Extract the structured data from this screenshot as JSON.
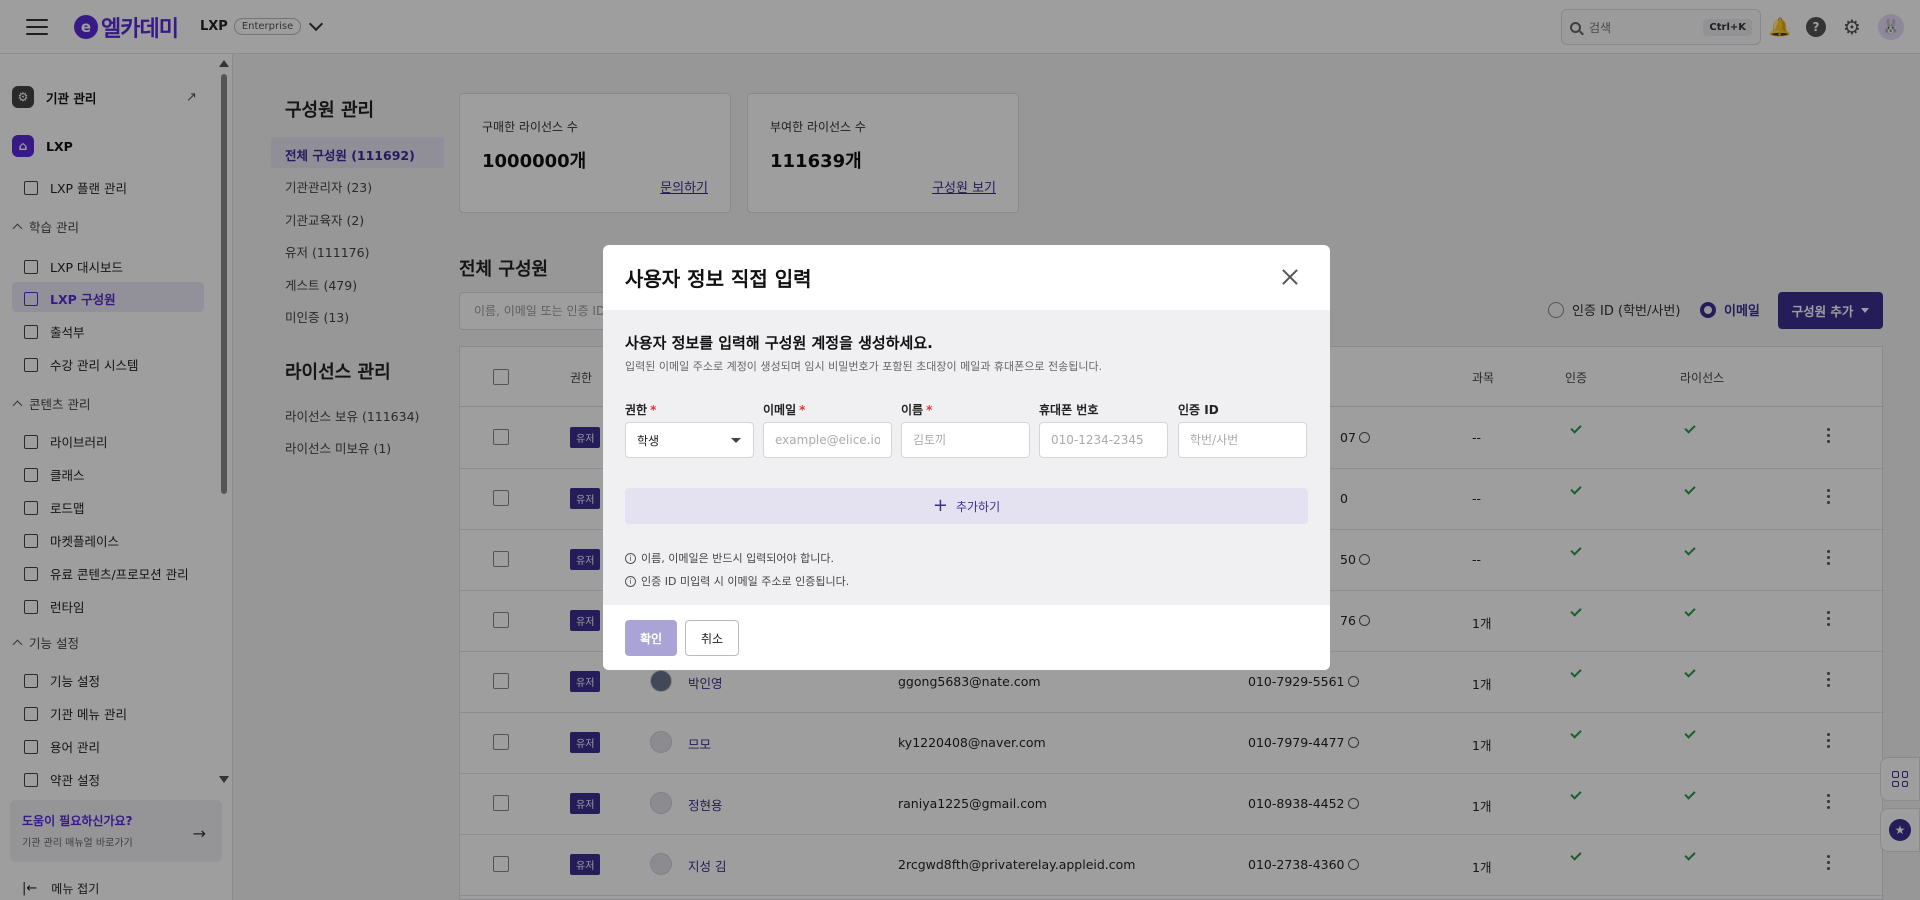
{
  "topbar": {
    "logo_mark": "e",
    "logo_text": "엘카데미",
    "product": "LXP",
    "edition": "Enterprise",
    "search_placeholder": "검색",
    "search_shortcut": "Ctrl+K"
  },
  "sidebar": {
    "org_manage": "기관 관리",
    "lxp": "LXP",
    "lxp_plan": "LXP 플랜 관리",
    "group_learning": "학습 관리",
    "lxp_dashboard": "LXP 대시보드",
    "lxp_members": "LXP 구성원",
    "attendance": "출석부",
    "enrollment": "수강 관리 시스템",
    "group_content": "콘텐츠 관리",
    "library": "라이브러리",
    "class": "클래스",
    "roadmap": "로드맵",
    "marketplace": "마켓플레이스",
    "paid_content": "유료 콘텐츠/프로모션 관리",
    "runtime": "런타임",
    "group_features": "기능 설정",
    "feature_settings": "기능 설정",
    "org_menu": "기관 메뉴 관리",
    "terms": "용어 관리",
    "policy": "약관 설정",
    "help_title": "도움이 필요하신가요?",
    "help_sub": "기관 관리 매뉴얼 바로가기",
    "collapse": "메뉴 접기"
  },
  "member_nav": {
    "title": "구성원 관리",
    "items": [
      "전체 구성원 (111692)",
      "기관관리자 (23)",
      "기관교육자 (2)",
      "유저 (111176)",
      "게스트 (479)",
      "미인증 (13)"
    ],
    "license_title": "라이선스 관리",
    "license_items": [
      "라이선스 보유 (111634)",
      "라이선스 미보유 (1)"
    ]
  },
  "cards": [
    {
      "label": "구매한 라이선스 수",
      "value": "1000000개",
      "link": "문의하기"
    },
    {
      "label": "부여한 라이선스 수",
      "value": "111639개",
      "link": "구성원 보기"
    }
  ],
  "list": {
    "title": "전체 구성원",
    "filter_placeholder": "이름, 이메일 또는 인증 ID",
    "radio_auth": "인증 ID (학번/사번)",
    "radio_email": "이메일",
    "add_button": "구성원 추가",
    "headers": {
      "role": "권한",
      "courses": "과목",
      "verified": "인증",
      "license": "라이선스"
    },
    "rows": [
      {
        "role": "유저",
        "name": "",
        "email": "",
        "phone": "07",
        "courses": "--",
        "verify": true
      },
      {
        "role": "유저",
        "name": "",
        "email": "",
        "phone": "0",
        "courses": "--",
        "verify": false
      },
      {
        "role": "유저",
        "name": "",
        "email": "",
        "phone": "50",
        "courses": "--",
        "verify": true
      },
      {
        "role": "유저",
        "name": "",
        "email": "",
        "phone": "76",
        "courses": "1개",
        "verify": true
      },
      {
        "role": "유저",
        "name": "박인영",
        "email": "ggong5683@nate.com",
        "phone": "010-7929-5561",
        "courses": "1개",
        "verify": true,
        "photo": true
      },
      {
        "role": "유저",
        "name": "므모",
        "email": "ky1220408@naver.com",
        "phone": "010-7979-4477",
        "courses": "1개",
        "verify": true
      },
      {
        "role": "유저",
        "name": "정현용",
        "email": "raniya1225@gmail.com",
        "phone": "010-8938-4452",
        "courses": "1개",
        "verify": true
      },
      {
        "role": "유저",
        "name": "지성 김",
        "email": "2rcgwd8fth@privaterelay.appleid.com",
        "phone": "010-2738-4360",
        "courses": "1개",
        "verify": true
      }
    ]
  },
  "modal": {
    "title": "사용자 정보 직접 입력",
    "subtitle": "사용자 정보를 입력해 구성원 계정을 생성하세요.",
    "description": "입력된 이메일 주소로 계정이 생성되며 임시 비밀번호가 포함된 초대장이 메일과 휴대폰으로 전송됩니다.",
    "fields": {
      "role_label": "권한",
      "role_value": "학생",
      "email_label": "이메일",
      "email_placeholder": "example@elice.io",
      "name_label": "이름",
      "name_placeholder": "김토끼",
      "phone_label": "휴대폰 번호",
      "phone_placeholder": "010-1234-2345",
      "auth_label": "인증 ID",
      "auth_placeholder": "학번/사번"
    },
    "required_mark": "*",
    "add_row": "추가하기",
    "note1": "이름, 이메일은 반드시 입력되어야 합니다.",
    "note2": "인증 ID 미입력 시 이메일 주소로 인증됩니다.",
    "confirm": "확인",
    "cancel": "취소"
  }
}
